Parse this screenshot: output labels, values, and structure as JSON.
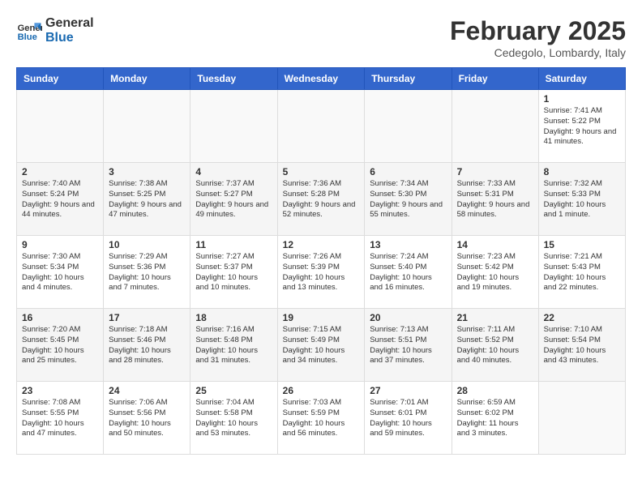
{
  "header": {
    "logo_line1": "General",
    "logo_line2": "Blue",
    "month_year": "February 2025",
    "location": "Cedegolo, Lombardy, Italy"
  },
  "days_of_week": [
    "Sunday",
    "Monday",
    "Tuesday",
    "Wednesday",
    "Thursday",
    "Friday",
    "Saturday"
  ],
  "weeks": [
    [
      {
        "day": "",
        "info": ""
      },
      {
        "day": "",
        "info": ""
      },
      {
        "day": "",
        "info": ""
      },
      {
        "day": "",
        "info": ""
      },
      {
        "day": "",
        "info": ""
      },
      {
        "day": "",
        "info": ""
      },
      {
        "day": "1",
        "info": "Sunrise: 7:41 AM\nSunset: 5:22 PM\nDaylight: 9 hours\nand 41 minutes."
      }
    ],
    [
      {
        "day": "2",
        "info": "Sunrise: 7:40 AM\nSunset: 5:24 PM\nDaylight: 9 hours\nand 44 minutes."
      },
      {
        "day": "3",
        "info": "Sunrise: 7:38 AM\nSunset: 5:25 PM\nDaylight: 9 hours\nand 47 minutes."
      },
      {
        "day": "4",
        "info": "Sunrise: 7:37 AM\nSunset: 5:27 PM\nDaylight: 9 hours\nand 49 minutes."
      },
      {
        "day": "5",
        "info": "Sunrise: 7:36 AM\nSunset: 5:28 PM\nDaylight: 9 hours\nand 52 minutes."
      },
      {
        "day": "6",
        "info": "Sunrise: 7:34 AM\nSunset: 5:30 PM\nDaylight: 9 hours\nand 55 minutes."
      },
      {
        "day": "7",
        "info": "Sunrise: 7:33 AM\nSunset: 5:31 PM\nDaylight: 9 hours\nand 58 minutes."
      },
      {
        "day": "8",
        "info": "Sunrise: 7:32 AM\nSunset: 5:33 PM\nDaylight: 10 hours\nand 1 minute."
      }
    ],
    [
      {
        "day": "9",
        "info": "Sunrise: 7:30 AM\nSunset: 5:34 PM\nDaylight: 10 hours\nand 4 minutes."
      },
      {
        "day": "10",
        "info": "Sunrise: 7:29 AM\nSunset: 5:36 PM\nDaylight: 10 hours\nand 7 minutes."
      },
      {
        "day": "11",
        "info": "Sunrise: 7:27 AM\nSunset: 5:37 PM\nDaylight: 10 hours\nand 10 minutes."
      },
      {
        "day": "12",
        "info": "Sunrise: 7:26 AM\nSunset: 5:39 PM\nDaylight: 10 hours\nand 13 minutes."
      },
      {
        "day": "13",
        "info": "Sunrise: 7:24 AM\nSunset: 5:40 PM\nDaylight: 10 hours\nand 16 minutes."
      },
      {
        "day": "14",
        "info": "Sunrise: 7:23 AM\nSunset: 5:42 PM\nDaylight: 10 hours\nand 19 minutes."
      },
      {
        "day": "15",
        "info": "Sunrise: 7:21 AM\nSunset: 5:43 PM\nDaylight: 10 hours\nand 22 minutes."
      }
    ],
    [
      {
        "day": "16",
        "info": "Sunrise: 7:20 AM\nSunset: 5:45 PM\nDaylight: 10 hours\nand 25 minutes."
      },
      {
        "day": "17",
        "info": "Sunrise: 7:18 AM\nSunset: 5:46 PM\nDaylight: 10 hours\nand 28 minutes."
      },
      {
        "day": "18",
        "info": "Sunrise: 7:16 AM\nSunset: 5:48 PM\nDaylight: 10 hours\nand 31 minutes."
      },
      {
        "day": "19",
        "info": "Sunrise: 7:15 AM\nSunset: 5:49 PM\nDaylight: 10 hours\nand 34 minutes."
      },
      {
        "day": "20",
        "info": "Sunrise: 7:13 AM\nSunset: 5:51 PM\nDaylight: 10 hours\nand 37 minutes."
      },
      {
        "day": "21",
        "info": "Sunrise: 7:11 AM\nSunset: 5:52 PM\nDaylight: 10 hours\nand 40 minutes."
      },
      {
        "day": "22",
        "info": "Sunrise: 7:10 AM\nSunset: 5:54 PM\nDaylight: 10 hours\nand 43 minutes."
      }
    ],
    [
      {
        "day": "23",
        "info": "Sunrise: 7:08 AM\nSunset: 5:55 PM\nDaylight: 10 hours\nand 47 minutes."
      },
      {
        "day": "24",
        "info": "Sunrise: 7:06 AM\nSunset: 5:56 PM\nDaylight: 10 hours\nand 50 minutes."
      },
      {
        "day": "25",
        "info": "Sunrise: 7:04 AM\nSunset: 5:58 PM\nDaylight: 10 hours\nand 53 minutes."
      },
      {
        "day": "26",
        "info": "Sunrise: 7:03 AM\nSunset: 5:59 PM\nDaylight: 10 hours\nand 56 minutes."
      },
      {
        "day": "27",
        "info": "Sunrise: 7:01 AM\nSunset: 6:01 PM\nDaylight: 10 hours\nand 59 minutes."
      },
      {
        "day": "28",
        "info": "Sunrise: 6:59 AM\nSunset: 6:02 PM\nDaylight: 11 hours\nand 3 minutes."
      },
      {
        "day": "",
        "info": ""
      }
    ]
  ]
}
